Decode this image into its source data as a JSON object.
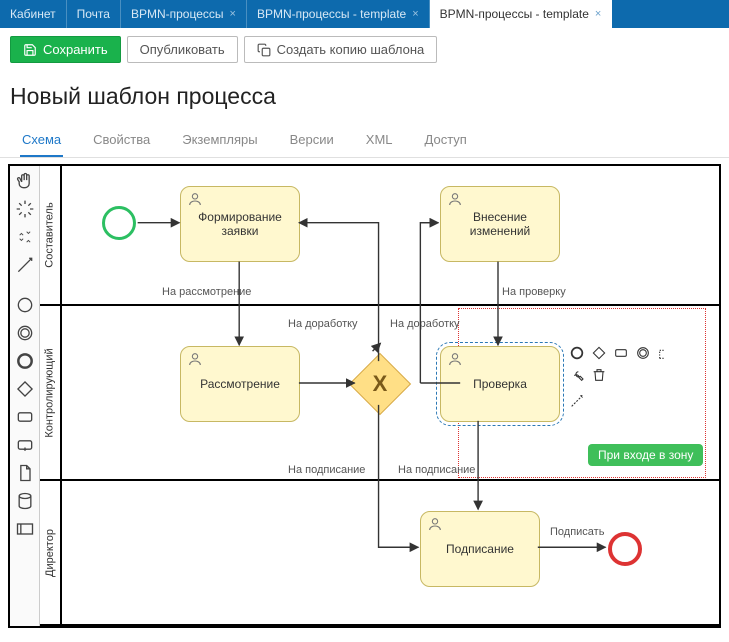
{
  "topbar": {
    "tabs": [
      {
        "label": "Кабинет",
        "closable": false
      },
      {
        "label": "Почта",
        "closable": false
      },
      {
        "label": "BPMN-процессы",
        "closable": true
      },
      {
        "label": "BPMN-процессы - template",
        "closable": true
      },
      {
        "label": "BPMN-процессы - template",
        "closable": true,
        "active": true
      }
    ]
  },
  "toolbar": {
    "save": "Сохранить",
    "publish": "Опубликовать",
    "copy": "Создать копию шаблона"
  },
  "page_title": "Новый шаблон процесса",
  "view_tabs": [
    "Схема",
    "Свойства",
    "Экземпляры",
    "Версии",
    "XML",
    "Доступ"
  ],
  "view_tab_active": 0,
  "lanes": [
    {
      "name": "Составитель"
    },
    {
      "name": "Контролирующий"
    },
    {
      "name": "Директор"
    }
  ],
  "tasks": {
    "form": "Формирование заявки",
    "review": "Рассмотрение",
    "changes": "Внесение изменений",
    "check": "Проверка",
    "sign": "Подписание"
  },
  "edges": {
    "to_review": "На рассмотрение",
    "to_rework1": "На доработку",
    "to_rework2": "На доработку",
    "to_check": "На проверку",
    "to_sign1": "На подписание",
    "to_sign2": "На подписание",
    "sign_it": "Подписать"
  },
  "zone_badge": "При входе в зону"
}
